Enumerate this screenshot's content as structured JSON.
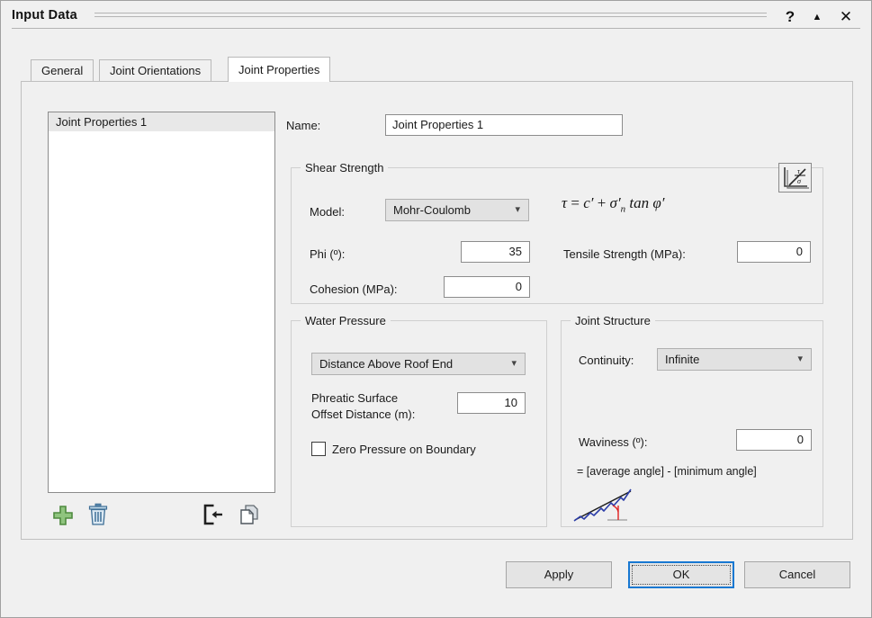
{
  "window": {
    "title": "Input Data",
    "controls": {
      "help": "?",
      "collapse": "▲",
      "close": "✕"
    }
  },
  "tabs": [
    {
      "label": "General",
      "active": false
    },
    {
      "label": "Joint Orientations",
      "active": false
    },
    {
      "label": "Joint Properties",
      "active": true
    }
  ],
  "list": {
    "items": [
      {
        "label": "Joint Properties 1",
        "selected": true
      }
    ],
    "toolbar": {
      "add": "add-icon",
      "delete": "delete-icon",
      "import": "import-icon",
      "copy": "copy-icon"
    }
  },
  "name_row": {
    "label": "Name:",
    "value": "Joint Properties 1",
    "placeholder": "Joint Properties 1"
  },
  "shear_strength": {
    "title": "Shear Strength",
    "model_label": "Model:",
    "model_value": "Mohr-Coulomb",
    "model_options": [
      "Mohr-Coulomb"
    ],
    "phi_label": "Phi (º):",
    "phi_value": "35",
    "cohesion_label": "Cohesion (MPa):",
    "cohesion_value": "0",
    "tensile_label": "Tensile Strength (MPa):",
    "tensile_value": "0",
    "formula": {
      "tau": "τ",
      "equals": "=",
      "c": "c",
      "prime1": "′",
      "plus": "+",
      "sigma": "σ",
      "prime2": "′",
      "sub_n": "n",
      "tan": "tan",
      "phi": "φ",
      "prime3": "′",
      "text": "τ = c′ + σ′n tan φ′"
    },
    "chart_button": "shear-strength-plot-icon"
  },
  "water_pressure": {
    "title": "Water Pressure",
    "mode_value": "Distance Above Roof End",
    "mode_options": [
      "Distance Above Roof End"
    ],
    "phreatic_label_line1": "Phreatic Surface",
    "phreatic_label_line2": "Offset Distance (m):",
    "phreatic_value": "10",
    "zero_pressure_label": "Zero Pressure on Boundary",
    "zero_pressure_checked": false
  },
  "joint_structure": {
    "title": "Joint Structure",
    "continuity_label": "Continuity:",
    "continuity_value": "Infinite",
    "continuity_options": [
      "Infinite"
    ],
    "waviness_label": "Waviness (º):",
    "waviness_value": "0",
    "waviness_note": "= [average angle] - [minimum angle]",
    "sketch": "waviness-diagram-icon"
  },
  "footer": {
    "apply": "Apply",
    "ok": "OK",
    "cancel": "Cancel"
  },
  "colors": {
    "window_bg": "#f0f0f0",
    "field_bg": "#ffffff",
    "combo_bg": "#e2e2e2",
    "focus_blue": "#1878d2",
    "add_green": "#5fa94f",
    "trash_blue": "#3f6f96",
    "waviness_red": "#e02020",
    "waviness_blue": "#2b3da8"
  }
}
